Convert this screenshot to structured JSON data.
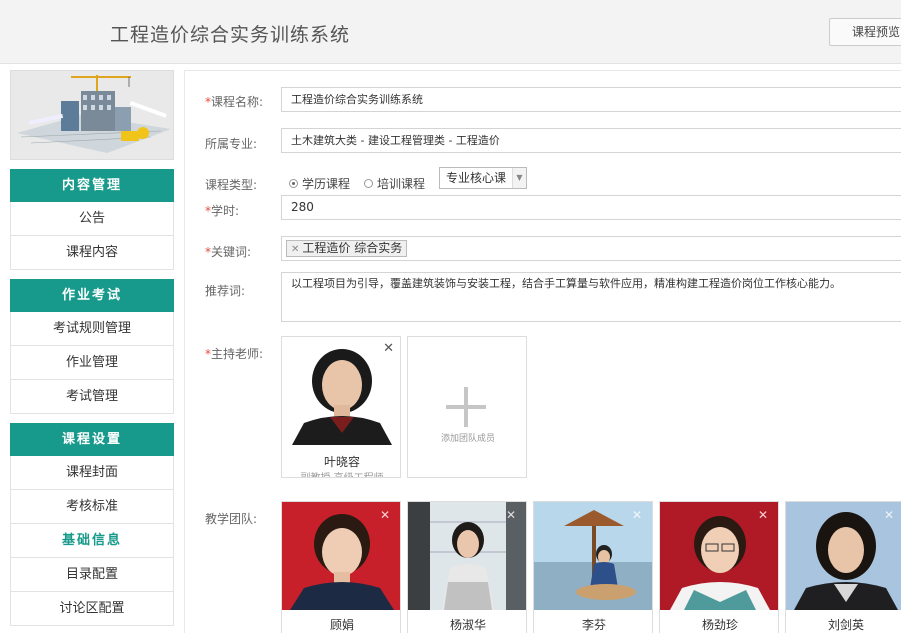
{
  "header": {
    "title": "工程造价综合实务训练系统",
    "preview_button": "课程预览"
  },
  "sidebar": {
    "sections": [
      {
        "title": "内容管理",
        "items": [
          "公告",
          "课程内容"
        ]
      },
      {
        "title": "作业考试",
        "items": [
          "考试规则管理",
          "作业管理",
          "考试管理"
        ]
      },
      {
        "title": "课程设置",
        "items": [
          "课程封面",
          "考核标准",
          "基础信息",
          "目录配置",
          "讨论区配置"
        ]
      }
    ],
    "active_item": "基础信息"
  },
  "form": {
    "course_name_label": "课程名称:",
    "course_name_value": "工程造价综合实务训练系统",
    "major_label": "所属专业:",
    "major_value": "土木建筑大类 - 建设工程管理类 - 工程造价",
    "type_label": "课程类型:",
    "type_options": [
      "学历课程",
      "培训课程"
    ],
    "type_selected": "学历课程",
    "type_select_value": "专业核心课",
    "hours_label": "学时:",
    "hours_value": "280",
    "keywords_label": "关键词:",
    "keywords_tag": "工程造价 综合实务",
    "recommend_label": "推荐词:",
    "recommend_value": "以工程项目为引导，覆盖建筑装饰与安装工程，结合手工算量与软件应用，精准构建工程造价岗位工作核心能力。",
    "host_label": "主持老师:",
    "host_name": "叶晓容",
    "host_sub": "副教授 高级工程师",
    "add_member_label": "添加团队成员",
    "team_label": "教学团队:",
    "team": [
      "顾娟",
      "杨淑华",
      "李芬",
      "杨劲珍",
      "刘剑英"
    ]
  }
}
